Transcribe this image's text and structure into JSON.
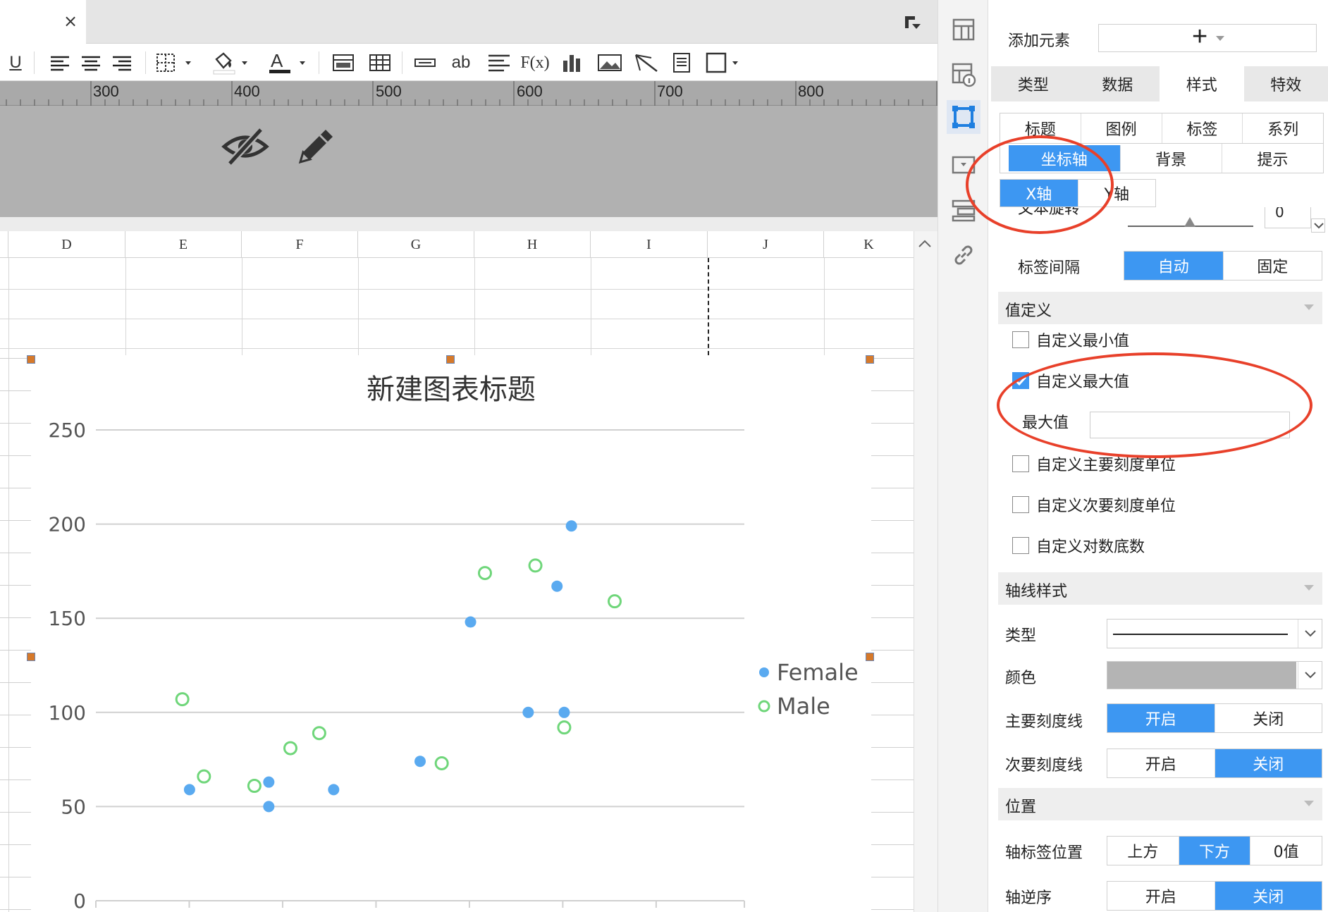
{
  "editor": {
    "close_glyph": "×",
    "ruler_numbers": [
      "300",
      "400",
      "500",
      "600",
      "700",
      "800"
    ],
    "columns": [
      "D",
      "E",
      "F",
      "G",
      "H",
      "I",
      "J",
      "K"
    ]
  },
  "toolbar_icons": [
    "underline-icon",
    "align-left-icon",
    "align-center-icon",
    "align-right-icon",
    "border-icon",
    "fill-color-icon",
    "font-color-icon",
    "merge-icon",
    "split-icon",
    "insert-row-icon",
    "text-ab-icon",
    "paragraph-icon",
    "formula-icon",
    "bar-chart-icon",
    "image-icon",
    "slash-icon",
    "page-icon",
    "border-style-icon"
  ],
  "toolbar": {
    "underline": "U",
    "font_color": "A",
    "text_ab": "ab",
    "formula": "F(x)"
  },
  "chart_data": {
    "type": "scatter",
    "title": "新建图表标题",
    "xlabel": "",
    "ylabel": "",
    "ylim": [
      0,
      250
    ],
    "yticks": [
      "0",
      "50",
      "100",
      "150",
      "200",
      "250"
    ],
    "legend_position": "right",
    "series": [
      {
        "name": "Female",
        "color": "#5aaaf0",
        "marker": "filled-circle",
        "points": [
          [
            13,
            59
          ],
          [
            24,
            50
          ],
          [
            24,
            63
          ],
          [
            33,
            59
          ],
          [
            45,
            74
          ],
          [
            52,
            148
          ],
          [
            60,
            100
          ],
          [
            64,
            167
          ],
          [
            65,
            100
          ],
          [
            66,
            199
          ]
        ]
      },
      {
        "name": "Male",
        "color": "#6fd67a",
        "marker": "hollow-circle",
        "points": [
          [
            12,
            107
          ],
          [
            15,
            66
          ],
          [
            22,
            61
          ],
          [
            27,
            81
          ],
          [
            31,
            89
          ],
          [
            48,
            73
          ],
          [
            54,
            174
          ],
          [
            61,
            178
          ],
          [
            65,
            92
          ],
          [
            72,
            159
          ]
        ]
      }
    ]
  },
  "sidebar_icons": [
    "layout-icon",
    "cell-info-icon",
    "chart-select-icon",
    "widget-icon",
    "list-icon",
    "link-icon"
  ],
  "panel": {
    "add_element_label": "添加元素",
    "add_glyph": "+",
    "main_tabs": [
      {
        "label": "类型",
        "active": false
      },
      {
        "label": "数据",
        "active": false
      },
      {
        "label": "样式",
        "active": true
      },
      {
        "label": "特效",
        "active": false
      }
    ],
    "style_tabs_row1": [
      "标题",
      "图例",
      "标签",
      "系列"
    ],
    "style_tabs_row2": [
      {
        "label": "坐标轴",
        "active": true
      },
      {
        "label": "背景",
        "active": false
      },
      {
        "label": "提示",
        "active": false
      }
    ],
    "axis_tabs": [
      {
        "label": "X轴",
        "active": true
      },
      {
        "label": "Y轴",
        "active": false
      }
    ],
    "text_rotation_label": "文本旋转",
    "text_rotation_value": "0",
    "label_interval": {
      "label": "标签间隔",
      "options": [
        "自动",
        "固定"
      ],
      "active": 0
    },
    "value_definition": {
      "title": "值定义",
      "custom_min": {
        "label": "自定义最小值",
        "checked": false
      },
      "custom_max": {
        "label": "自定义最大值",
        "checked": true
      },
      "max_value_label": "最大值",
      "max_value": "",
      "custom_major_unit": {
        "label": "自定义主要刻度单位",
        "checked": false
      },
      "custom_minor_unit": {
        "label": "自定义次要刻度单位",
        "checked": false
      },
      "custom_log_base": {
        "label": "自定义对数底数",
        "checked": false
      }
    },
    "axis_style": {
      "title": "轴线样式",
      "type_label": "类型",
      "color_label": "颜色",
      "color_value": "#b4b4b4",
      "major_tick": {
        "label": "主要刻度线",
        "options": [
          "开启",
          "关闭"
        ],
        "active": 0
      },
      "minor_tick": {
        "label": "次要刻度线",
        "options": [
          "开启",
          "关闭"
        ],
        "active": 1
      }
    },
    "position": {
      "title": "位置",
      "label_position": {
        "label": "轴标签位置",
        "options": [
          "上方",
          "下方",
          "0值"
        ],
        "active": 1
      },
      "reverse": {
        "label": "轴逆序",
        "options": [
          "开启",
          "关闭"
        ],
        "active": 1
      }
    }
  }
}
